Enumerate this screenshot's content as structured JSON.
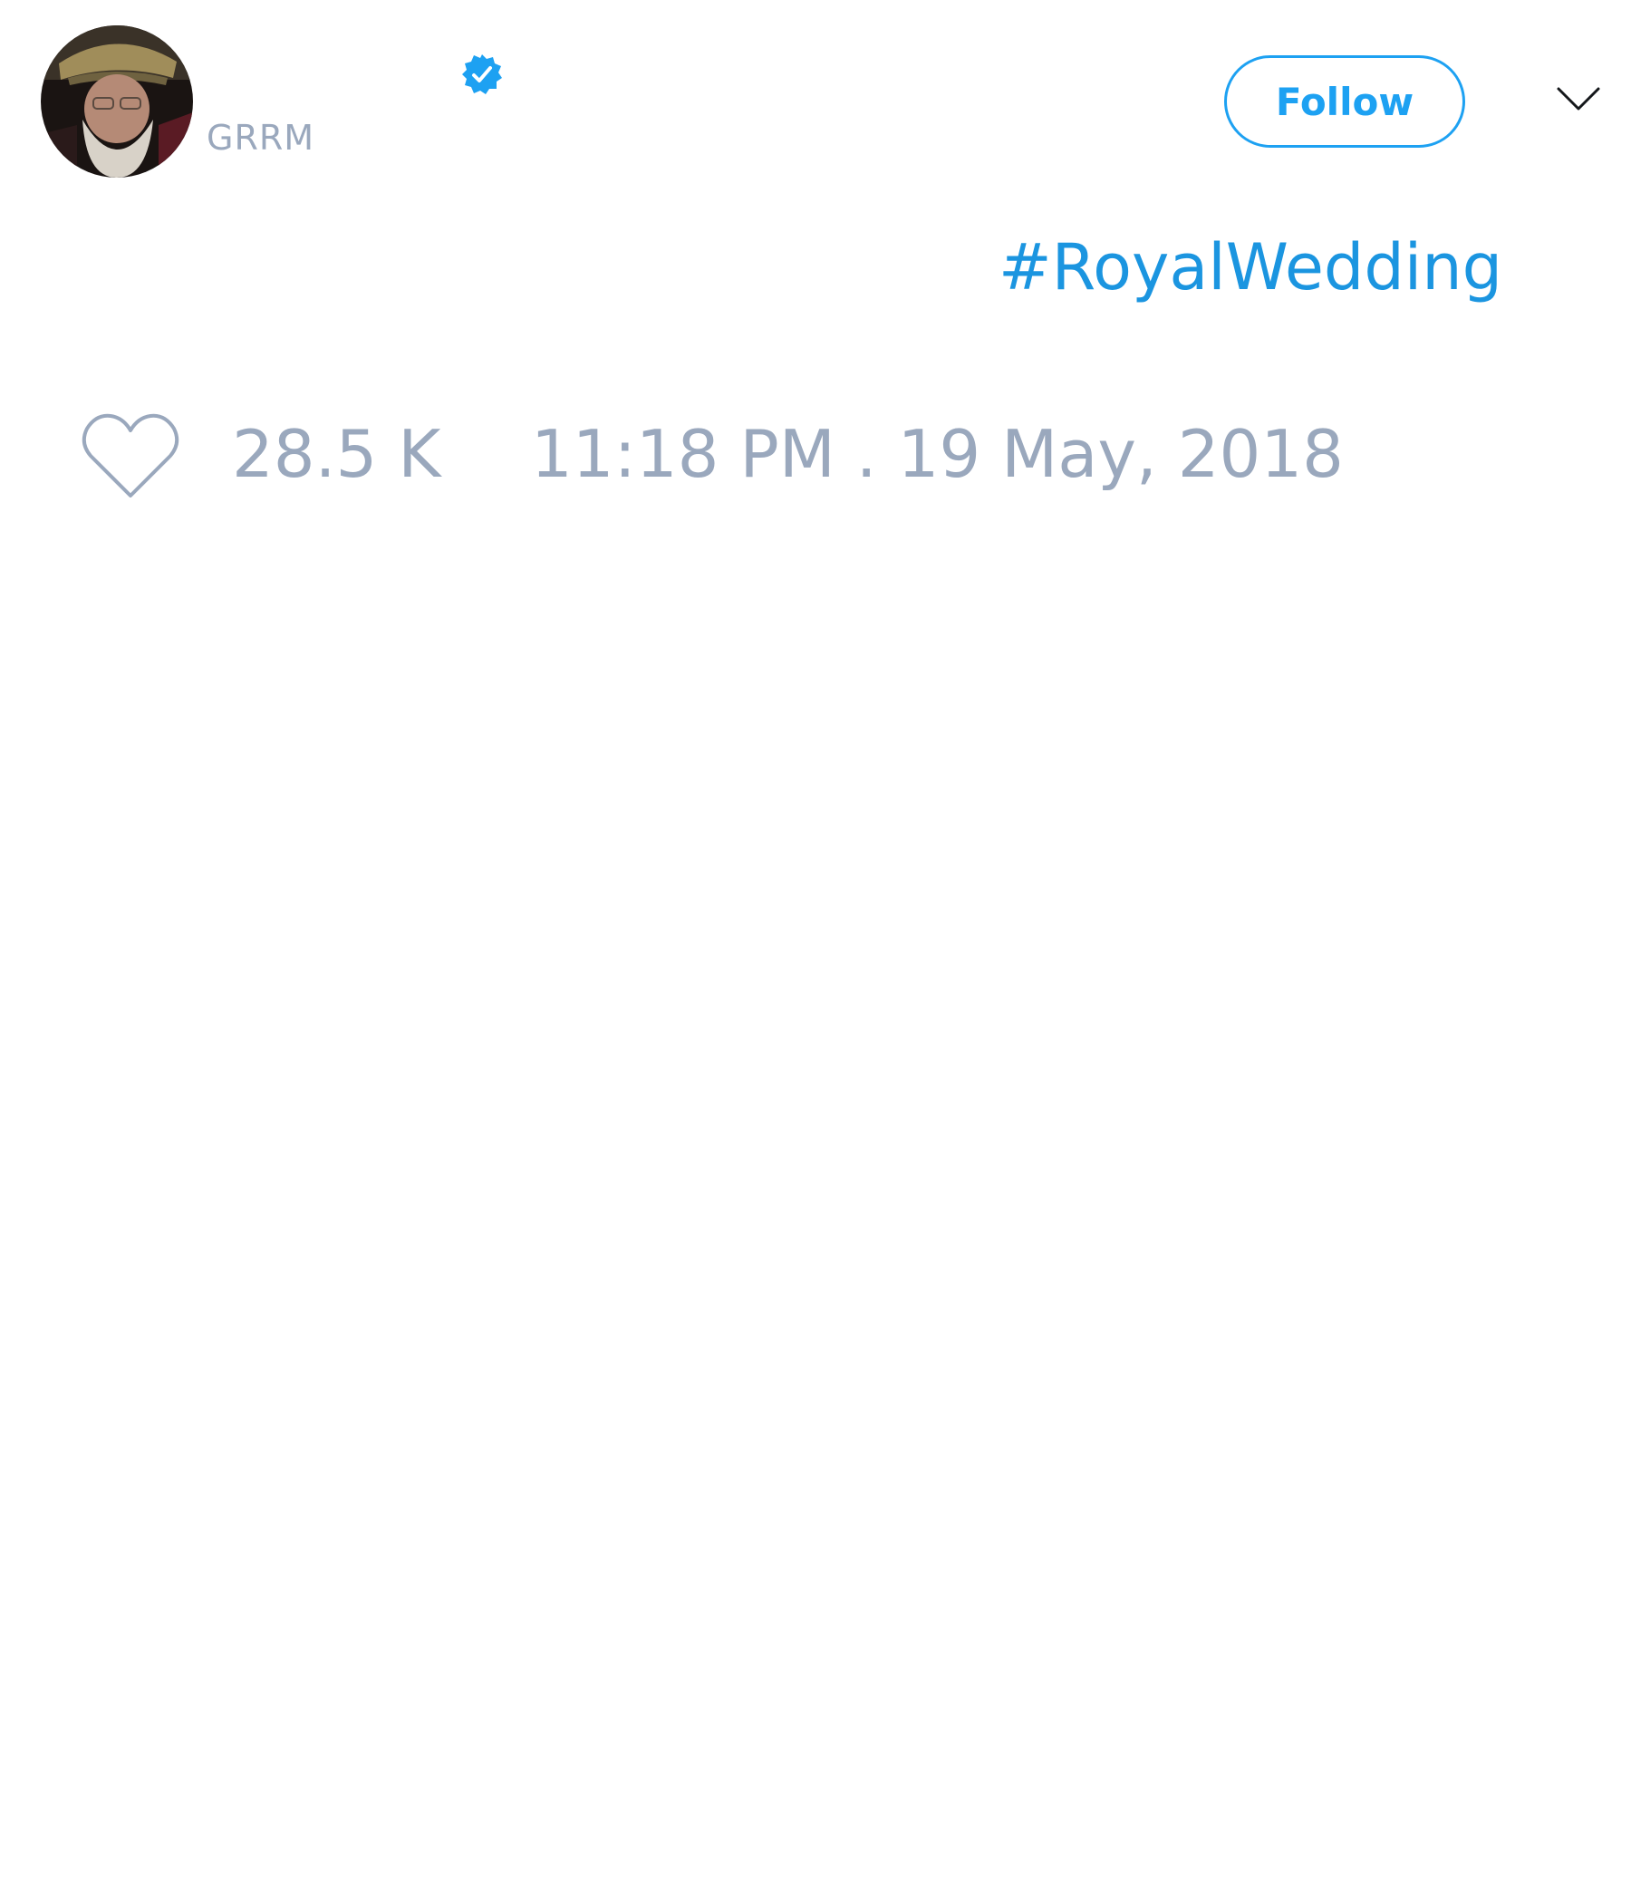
{
  "author": {
    "display_name": "",
    "handle": "GRRM",
    "verified_icon": "verified-badge-icon",
    "avatar_alt": "profile photo"
  },
  "header": {
    "follow_label": "Follow",
    "menu_icon": "chevron-down-icon"
  },
  "tweet": {
    "text": "#RoyalWedding"
  },
  "footer": {
    "like_icon": "heart-outline-icon",
    "likes_count": "28.5 K",
    "timestamp": "11:18 PM . 19 May, 2018"
  },
  "colors": {
    "accent": "#1da1f2",
    "hashtag": "#1b95e0",
    "muted": "#9aa8bd"
  }
}
